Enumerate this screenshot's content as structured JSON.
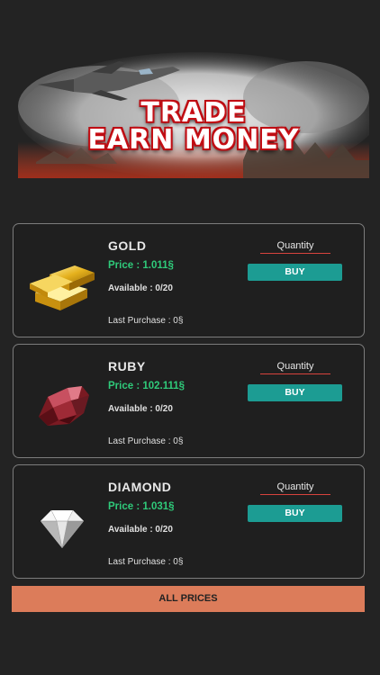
{
  "banner": {
    "line1": "TRADE",
    "line2": "EARN MONEY"
  },
  "items": [
    {
      "name": "GOLD",
      "price": "Price : 1.011§",
      "available": "Available : 0/20",
      "quantity_placeholder": "Quantity",
      "buy_label": "BUY",
      "last_purchase": "Last Purchase : 0§",
      "icon": "gold-bars-icon"
    },
    {
      "name": "RUBY",
      "price": "Price : 102.111§",
      "available": "Available : 0/20",
      "quantity_placeholder": "Quantity",
      "buy_label": "BUY",
      "last_purchase": "Last Purchase : 0§",
      "icon": "ruby-icon"
    },
    {
      "name": "DIAMOND",
      "price": "Price : 1.031§",
      "available": "Available : 0/20",
      "quantity_placeholder": "Quantity",
      "buy_label": "BUY",
      "last_purchase": "Last Purchase : 0§",
      "icon": "diamond-icon"
    }
  ],
  "footer": {
    "all_prices_label": "ALL PRICES"
  },
  "colors": {
    "background": "#232323",
    "price_green": "#2fca7a",
    "buy_teal": "#1c9c93",
    "all_prices_orange": "#dc7c5a",
    "banner_red": "#d8121a"
  }
}
